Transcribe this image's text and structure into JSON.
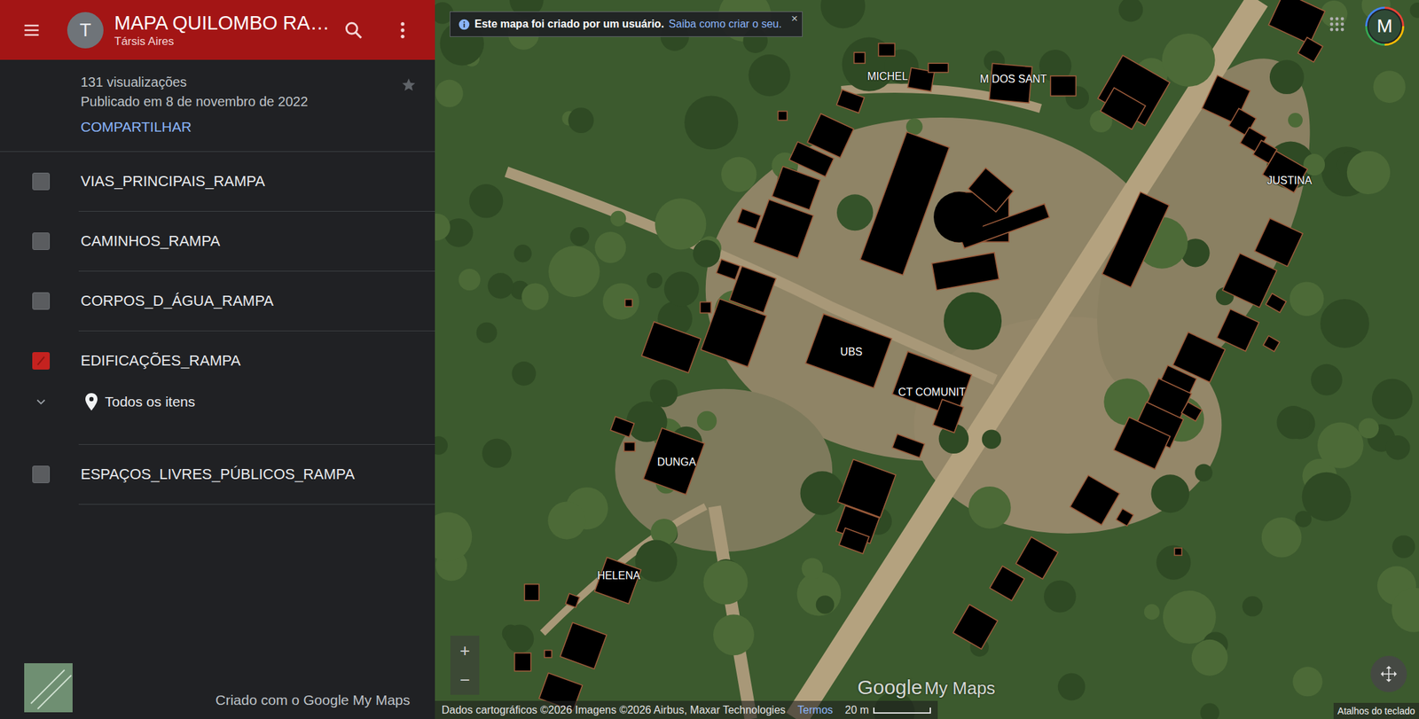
{
  "header": {
    "avatar": "T",
    "title": "MAPA QUILOMBO RA…",
    "author": "Társis Aires"
  },
  "info": {
    "views": "131 visualizações",
    "published": "Publicado em 8 de novembro de 2022",
    "share": "COMPARTILHAR"
  },
  "layers": [
    {
      "name": "VIAS_PRINCIPAIS_RAMPA",
      "checked": false,
      "expanded": false,
      "items": []
    },
    {
      "name": "CAMINHOS_RAMPA",
      "checked": false,
      "expanded": false,
      "items": []
    },
    {
      "name": "CORPOS_D_ÁGUA_RAMPA",
      "checked": false,
      "expanded": false,
      "items": []
    },
    {
      "name": "EDIFICAÇÕES_RAMPA",
      "checked": true,
      "expanded": true,
      "items": [
        "Todos os itens"
      ]
    },
    {
      "name": "ESPAÇOS_LIVRES_PÚBLICOS_RAMPA",
      "checked": false,
      "expanded": false,
      "items": []
    }
  ],
  "footer": {
    "credit": "Criado com o Google My Maps"
  },
  "map": {
    "notice": {
      "text": "Este mapa foi criado por um usuário.",
      "link": "Saiba como criar o seu.",
      "close": "×"
    },
    "labels": [
      "MICHEL",
      "M DOS SANT",
      "JUSTINA",
      "UBS",
      "CT COMUNIT",
      "DUNGA",
      "HELENA"
    ],
    "zoom": [
      "+",
      "−"
    ],
    "logo": {
      "google": "Google",
      "product": "My Maps"
    },
    "attribution": "Dados cartográficos ©2026 Imagens ©2026 Airbus, Maxar Technologies",
    "terms": "Termos",
    "scale": "20 m",
    "shortcuts": "Atalhos do teclado",
    "account": "M"
  }
}
